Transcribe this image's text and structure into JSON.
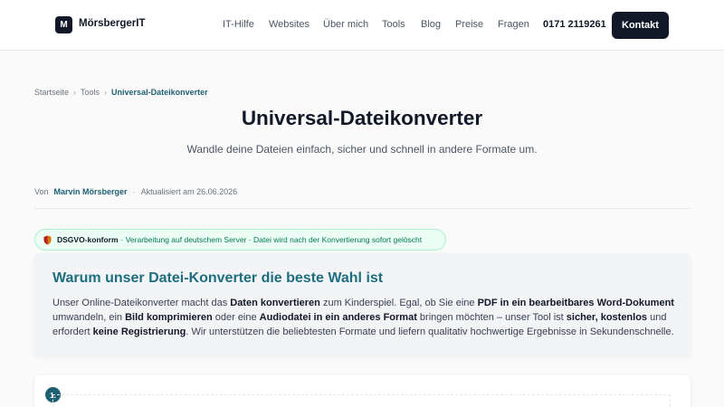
{
  "header": {
    "logo_letter": "M",
    "brand": "MörsbergerIT",
    "nav": [
      "IT-Hilfe",
      "Websites",
      "Über mich",
      "Tools",
      "Blog",
      "Preise",
      "Fragen"
    ],
    "phone": "0171 2119261",
    "contact_label": "Kontakt"
  },
  "breadcrumb": {
    "home": "Startseite",
    "tools": "Tools",
    "current": "Universal-Dateikonverter"
  },
  "page": {
    "title": "Universal-Dateikonverter",
    "subtitle": "Wandle deine Dateien einfach, sicher und schnell in andere Formate um."
  },
  "meta": {
    "by": "Von",
    "author": "Marvin Mörsberger",
    "separator": "·",
    "updated": "Aktualisiert am 26.06.2026"
  },
  "badge": {
    "label": "DSGVO-konform",
    "text": "· Verarbeitung auf deutschem Server · Datei wird nach der Konvertierung sofort gelöscht"
  },
  "card": {
    "title": "Warum unser Datei-Konverter die beste Wahl ist",
    "parts": [
      "Unser Online-Dateikonverter macht das ",
      "Daten konvertieren",
      " zum Kinderspiel. Egal, ob Sie eine ",
      "PDF in ein bearbeitbares Word-Dokument",
      " umwandeln, ein ",
      "Bild komprimieren",
      " oder eine ",
      "Audiodatei in ein anderes Format",
      " bringen möchten – unser Tool ist ",
      "sicher, kostenlos",
      " und erfordert ",
      "keine Registrierung",
      ". Wir unterstützen die beliebtesten Formate und liefern qualitativ hochwertige Ergebnisse in Sekundenschnelle."
    ]
  },
  "step": {
    "number": "1."
  },
  "colors": {
    "accent": "#1e5f74",
    "dark": "#111827",
    "badge_bg": "#ecfdf5",
    "badge_text": "#047857",
    "card_title": "#1e6e80"
  }
}
